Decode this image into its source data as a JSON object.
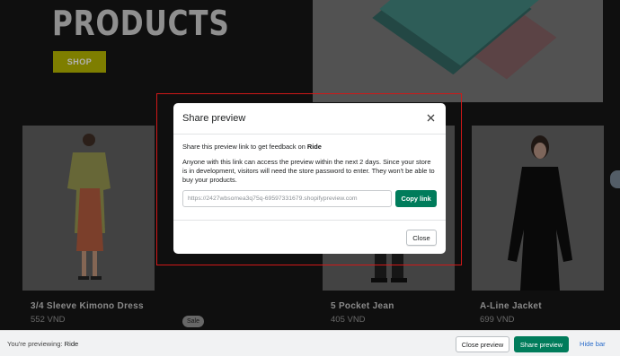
{
  "store": {
    "hero_title": "PRODUCTS",
    "shop_label": "SHOP",
    "products": [
      {
        "name": "3/4 Sleeve Kimono Dress",
        "price": "552 VND"
      },
      {
        "name": "5 Pocket Jean",
        "price": "405 VND"
      },
      {
        "name": "A-Line Jacket",
        "price": "699 VND"
      }
    ],
    "sale_badge": "Sale"
  },
  "modal": {
    "title": "Share preview",
    "intro_prefix": "Share this preview link to get feedback on ",
    "store_name": "Ride",
    "description": "Anyone with this link can access the preview within the next 2 days. Since your store is in development, visitors will need the store password to enter. They won't be able to buy your products.",
    "link_value": "https://2427wbsomea3q75q-69597331679.shopifypreview.com",
    "copy_label": "Copy link",
    "close_label": "Close"
  },
  "preview_bar": {
    "previewing_prefix": "You're previewing: ",
    "theme_name": "Ride",
    "close_preview_label": "Close preview",
    "share_preview_label": "Share preview",
    "hide_bar_label": "Hide bar"
  },
  "colors": {
    "primary_button": "#007c5b",
    "shop_button": "#a8a800",
    "highlight_border": "#d01818",
    "link": "#2c6ecb"
  },
  "icons": {
    "modal_close": "close-icon"
  }
}
